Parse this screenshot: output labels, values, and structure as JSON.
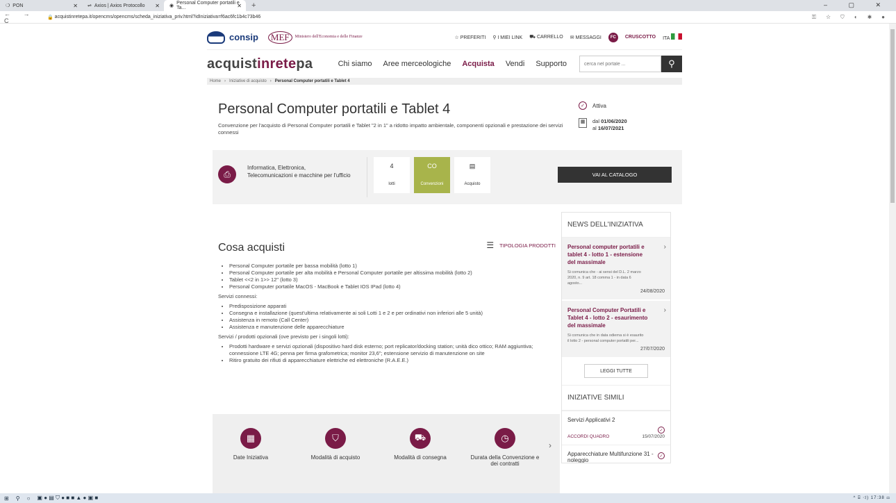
{
  "browser": {
    "tabs": [
      {
        "label": "PON"
      },
      {
        "label": "Axios | Axios Protocollo"
      },
      {
        "label": "Personal Computer portatili e Ta..."
      }
    ],
    "url": "acquistinretepa.it/opencms/opencms/scheda_iniziativa_priv.html?idIniziativa=f6ac6fc1b4c73b46"
  },
  "header": {
    "consip": "consip",
    "mef_badge": "MEF",
    "mef_text": "Ministero dell'Economia e delle Finanze",
    "utils": [
      "PREFERITI",
      "I MIEI LINK",
      "CARRELLO",
      "MESSAGGI"
    ],
    "user_initials": "FC",
    "dashboard": "CRUSCOTTO",
    "lang": "ITA"
  },
  "nav": {
    "brand_a": "acquist",
    "brand_b": "inrete",
    "brand_c": "pa",
    "items": [
      "Chi siamo",
      "Aree merceologiche",
      "Acquista",
      "Vendi",
      "Supporto"
    ],
    "search_placeholder": "cerca nel portale ..."
  },
  "breadcrumb": [
    "Home",
    "Iniziative di acquisto",
    "Personal Computer portatili e Tablet 4"
  ],
  "hero": {
    "title": "Personal Computer portatili e Tablet 4",
    "desc": "Convenzione per l'acquisto di Personal Computer portatili e Tablet \"2 in 1\" a ridotto impatto ambientale, componenti opzionali e prestazione dei servizi connessi",
    "status": "Attiva",
    "date_from_label": "dal ",
    "date_from": "01/06/2020",
    "date_to_label": "al ",
    "date_to": "16/07/2021"
  },
  "band": {
    "category": "Informatica, Elettronica, Telecomunicazioni e macchine per l'ufficio",
    "tiles": [
      {
        "big": "4",
        "small": "lotti"
      },
      {
        "big": "CO",
        "small": "Convenzioni"
      },
      {
        "big": "",
        "small": "Acquisto"
      }
    ],
    "catalog_button": "VAI AL CATALOGO"
  },
  "content": {
    "title": "Cosa acquisti",
    "tipologia": "TIPOLOGIA PRODOTTI",
    "list1": [
      "Personal Computer portatile per bassa mobilità (lotto 1)",
      "Personal Computer portatile per alta mobilità e Personal Computer portatile per altissima mobilità (lotto 2)",
      "Tablet <<2 in 1>> 12\" (lotto 3)",
      "Personal Computer portatile MacOS - MacBook e Tablet IOS IPad (lotto 4)"
    ],
    "h2": "Servizi connessi:",
    "list2": [
      "Predisposizione apparati",
      "Consegna e installazione (quest'ultima relativamente ai soli Lotti 1 e 2 e per ordinativi non inferiori alle 5 unità)",
      "Assistenza in remoto (Call Center)",
      "Assistenza e manutenzione delle apparecchiature"
    ],
    "h3": "Servizi / prodotti opzionali (ove previsto per i singoli lotti):",
    "list3": [
      "Prodotti hardware e servizi opzionali (dispositivo hard disk esterno; port replicator/docking station; unità dico ottico; RAM aggiuntiva; connessione LTE 4G; penna per firma grafometrica; monitor 23,6\"; estensione servizio di manutenzione on site",
      "Ritiro gratuito dei rifiuti di apparecchiature elettriche ed elettroniche (R.A.E.E.)"
    ]
  },
  "icons": [
    "Date Iniziativa",
    "Modalità di acquisto",
    "Modalità di consegna",
    "Durata della Convenzione e dei contratti"
  ],
  "news": {
    "title": "NEWS DELL'INIZIATIVA",
    "items": [
      {
        "title": "Personal computer portatili e tablet 4 - lotto 1 - estensione del massimale",
        "desc": "Si comunica che - ai sensi del D.L. 2 marzo 2020, n. 9 art. 18 comma 1 - in data 6 agosto...",
        "date": "24/08/2020"
      },
      {
        "title": "Personal Computer Portatili e Tablet 4 - lotto 2 - esaurimento del massimale",
        "desc": "Si comunica che in data odierna si è esaurito il lotto 2 - personal computer portatili per...",
        "date": "27/07/2020"
      }
    ],
    "all": "LEGGI TUTTE"
  },
  "similar": {
    "title": "INIZIATIVE SIMILI",
    "items": [
      {
        "name": "Servizi Applicativi 2",
        "cat": "ACCORDI QUADRO",
        "date": "15/07/2020"
      },
      {
        "name": "Apparecchiature Multifunzione 31 - noleggio"
      }
    ]
  },
  "taskbar": {
    "time": "17:38"
  }
}
